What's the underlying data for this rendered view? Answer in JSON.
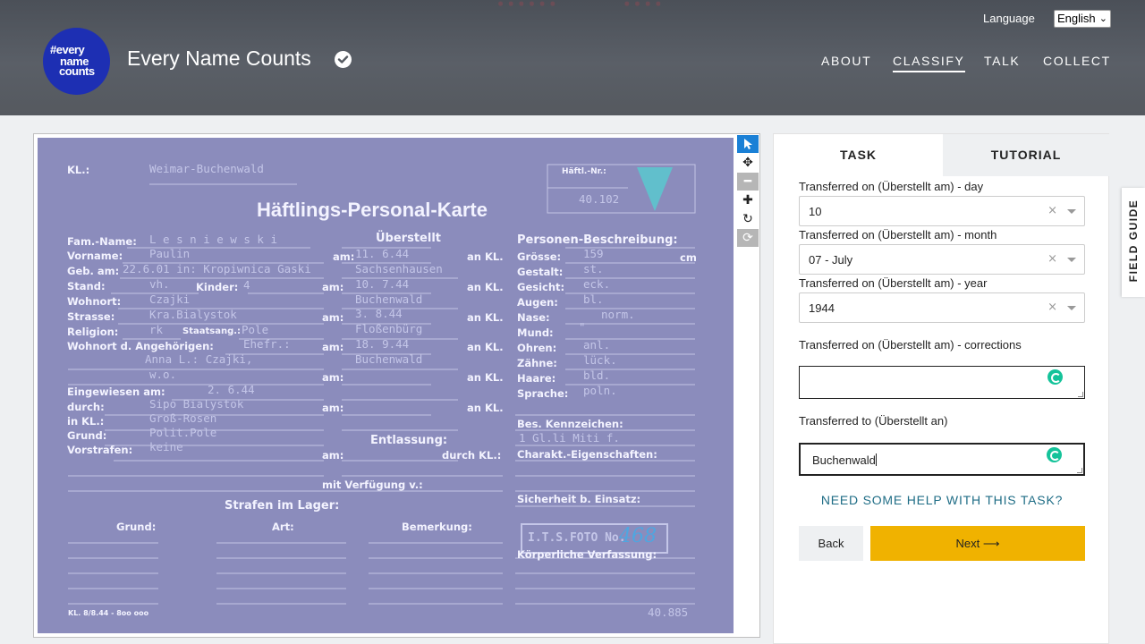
{
  "header": {
    "logo_lines": [
      "#every",
      "name",
      "counts"
    ],
    "site_title": "Every Name Counts",
    "nav": [
      "ABOUT",
      "CLASSIFY",
      "TALK",
      "COLLECT"
    ],
    "active_nav": "CLASSIFY",
    "language_label": "Language",
    "language_value": "English"
  },
  "toolbar": {
    "tools": [
      "pointer-icon",
      "move-icon",
      "zoom-out-icon",
      "zoom-in-icon",
      "rotate-icon",
      "reset-icon"
    ]
  },
  "card": {
    "kl_label": "KL.:",
    "kl_value": "Weimar-Buchenwald",
    "hafl_label": "Häftl.-Nr.:",
    "hafl_value": "40.102",
    "title": "Häftlings-Personal-Karte",
    "uberstellt": "Überstellt",
    "personen": "Personen-Beschreibung:",
    "left_labels": [
      "Fam.-Name:",
      "Vorname:",
      "Geb. am:",
      "Stand:",
      "Wohnort:",
      "Strasse:",
      "Religion:",
      "Wohnort d. Angehörigen:",
      "Eingewiesen am:",
      "durch:",
      "in KL.:",
      "Grund:",
      "Vorstrafen:"
    ],
    "left_values": [
      "L e s n i e w s k i",
      "Paulin",
      "22.6.01 in: Kropiwnica Gaski",
      "vh.",
      "Czajki",
      "Kra.Bialystok",
      "rk",
      "Ehefr.:",
      "Anna L.: Czajki,",
      "w.o.",
      "2. 6.44",
      "Sipo Bialystok",
      "Groß-Rosen",
      "Polit.Pole",
      "keine"
    ],
    "kinder_label": "Kinder:",
    "kinder_value": "4",
    "staatsang_label": "Staatsang.:",
    "staatsang_value": "Pole",
    "transfers": [
      {
        "date": "11. 6.44",
        "to": "Sachsenhausen"
      },
      {
        "date": "10. 7.44",
        "to": "Buchenwald"
      },
      {
        "date": "3. 8.44",
        "to": "Floßenbürg"
      },
      {
        "date": "18. 9.44",
        "to": "Buchenwald"
      }
    ],
    "am_label": "am:",
    "ankl_label": "an KL.",
    "right_labels": [
      "Grösse:",
      "Gestalt:",
      "Gesicht:",
      "Augen:",
      "Nase:",
      "Mund:",
      "Ohren:",
      "Zähne:",
      "Haare:",
      "Sprache:"
    ],
    "right_values": [
      "159",
      "st.",
      "eck.",
      "bl.",
      "norm.",
      "\"",
      "anl.",
      "lück.",
      "bld.",
      "poln."
    ],
    "cm_label": "cm",
    "bes_label": "Bes. Kennzeichen:",
    "bes_value": "1 Gl.li Miti f.",
    "charakt_label": "Charakt.-Eigenschaften:",
    "sicherheit_label": "Sicherheit b. Einsatz:",
    "entlassung": "Entlassung:",
    "durch_kl": "durch KL.:",
    "verfugung": "mit Verfügung v.:",
    "strafen": "Strafen im Lager:",
    "grund": "Grund:",
    "art": "Art:",
    "bemerkung": "Bemerkung:",
    "stamp_text": "I.T.S.FOTO No.",
    "stamp_number": "468",
    "koerper": "Körperliche Verfassung:",
    "footer_left": "KL. 8/8.44 - 8oo ooo",
    "footer_right": "40.885"
  },
  "panel": {
    "tabs": [
      "TASK",
      "TUTORIAL"
    ],
    "field_day_label": "Transferred on (Überstellt am) - day",
    "field_day_value": "10",
    "field_month_label": "Transferred on (Überstellt am) - month",
    "field_month_value": "07 - July",
    "field_year_label": "Transferred on (Überstellt am) - year",
    "field_year_value": "1944",
    "corrections_label": "Transferred on (Überstellt am) - corrections",
    "corrections_value": "",
    "transferred_to_label": "Transferred to (Überstellt an)",
    "transferred_to_value": "Buchenwald",
    "help_link": "NEED SOME HELP WITH THIS TASK?",
    "back_label": "Back",
    "next_label": "Next ⟶"
  },
  "field_guide_label": "FIELD GUIDE",
  "colors": {
    "header": "#55595f",
    "logo": "#1d2fb3",
    "card": "#8b8cbc",
    "next_button": "#f0b200",
    "help_link": "#1f6d86",
    "active_tool": "#1a80d6"
  }
}
